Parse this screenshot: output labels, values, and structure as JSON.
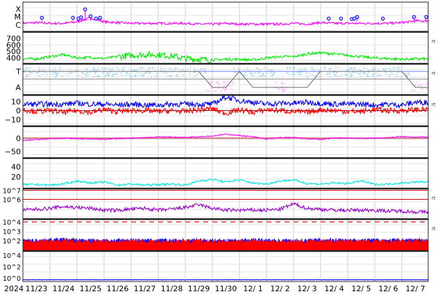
{
  "chart_data": {
    "type": "line",
    "title": "Space weather summary",
    "x_axis": {
      "year_label": "2024",
      "tick_labels": [
        "11/23",
        "11/24",
        "11/25",
        "11/26",
        "11/27",
        "11/28",
        "11/29",
        "11/30",
        "12/ 1",
        "12/ 2",
        "12/ 3",
        "12/ 4",
        "12/ 5",
        "12/ 6",
        "12/ 7"
      ],
      "points_per_day": 2
    },
    "panels": [
      {
        "name": "xray",
        "ytick_labels": [
          "X",
          "M",
          "C"
        ],
        "ylim_log": [
          -6.6,
          -3.8
        ],
        "ytick_values": [
          -4,
          -5,
          -6
        ],
        "rt": "",
        "series": [
          {
            "name": "xray-flux",
            "color": "#ff00ff",
            "values": [
              -5.8,
              -5.7,
              -5.8,
              -5.8,
              -5.6,
              -5.1,
              -5.6,
              -5.7,
              -5.8,
              -5.8,
              -5.8,
              -5.8,
              -5.8,
              -5.9,
              -5.9,
              -5.8,
              -5.9,
              -5.9,
              -5.9,
              -5.9,
              -5.8,
              -5.9,
              -5.7,
              -5.8,
              -5.8,
              -5.8,
              -5.8,
              -5.8,
              -5.7,
              -5.5
            ]
          }
        ],
        "flares_day": [
          0.7,
          1.85,
          2.05,
          2.15,
          2.3,
          2.5,
          2.7,
          2.85,
          11.3,
          11.75,
          12.15,
          12.25,
          12.35,
          13.3,
          14.45,
          14.9
        ],
        "flares_level": [
          -5.1,
          -5.1,
          -5.2,
          -5.05,
          -4.05,
          -4.9,
          -5.2,
          -5.1,
          -5.2,
          -5.2,
          -5.25,
          -5.2,
          -5.0,
          -5.2,
          -5.0,
          -5.0
        ]
      },
      {
        "name": "solar-wind-speed",
        "ytick_labels": [
          "700",
          "600",
          "500",
          "400"
        ],
        "ytick_values": [
          700,
          600,
          500,
          400
        ],
        "ylim": [
          310,
          800
        ],
        "rt": "rt",
        "series": [
          {
            "name": "speed",
            "color": "#00ee00",
            "values": [
              390,
              385,
              420,
              450,
              400,
              410,
              390,
              420,
              440,
              450,
              450,
              430,
              390,
              380,
              370,
              380,
              380,
              370,
              400,
              420,
              420,
              460,
              480,
              460,
              440,
              420,
              400,
              390,
              380,
              385
            ]
          }
        ]
      },
      {
        "name": "solar-wind-ta",
        "ytick_labels": [
          "T",
          "A"
        ],
        "rt": "rt",
        "series": [
          {
            "name": "temperature",
            "color": "#aaddff",
            "values": [
              1,
              1,
              1,
              1,
              1,
              1,
              1,
              1,
              1,
              1,
              1,
              1,
              1,
              1,
              0.3,
              0.2,
              1,
              1,
              1,
              0.3,
              1,
              1,
              1,
              1,
              1,
              1,
              1,
              1,
              1,
              0.3
            ]
          },
          {
            "name": "mode",
            "color": "#666666",
            "values": [
              1,
              1,
              1,
              1,
              1,
              1,
              1,
              1,
              1,
              1,
              1,
              1,
              1,
              1,
              0,
              0,
              1,
              0,
              0,
              0,
              0,
              0,
              1,
              1,
              1,
              1,
              1,
              1,
              1,
              0
            ]
          }
        ]
      },
      {
        "name": "imf",
        "ytick_labels": [
          "10",
          "0",
          "−10"
        ],
        "ytick_values": [
          10,
          0,
          -10
        ],
        "ylim": [
          -17,
          17
        ],
        "rt": "rt",
        "series": [
          {
            "name": "Bt",
            "color": "#0000ff",
            "values": [
              7,
              7,
              7,
              7,
              8,
              7,
              7,
              6,
              7,
              6,
              6,
              7,
              7,
              7,
              7,
              15,
              11,
              9,
              7,
              8,
              8,
              9,
              8,
              7,
              7,
              7,
              6,
              7,
              6,
              9
            ]
          },
          {
            "name": "Bz",
            "color": "#ff0000",
            "values": [
              1,
              -1,
              0,
              -2,
              0,
              -2,
              1,
              -1,
              0,
              0,
              -1,
              0,
              -1,
              1,
              2,
              -3,
              1,
              -2,
              1,
              0,
              -1,
              -2,
              1,
              0,
              -1,
              -1,
              1,
              0,
              0,
              1
            ]
          }
        ]
      },
      {
        "name": "dst",
        "ytick_labels": [
          "0",
          "−50"
        ],
        "ytick_values": [
          0,
          -50
        ],
        "ylim": [
          -75,
          45
        ],
        "rt": "",
        "series": [
          {
            "name": "dst",
            "color": "#ff00ff",
            "values": [
              -10,
              -5,
              -2,
              0,
              -2,
              -3,
              -5,
              -2,
              0,
              2,
              5,
              4,
              3,
              6,
              8,
              15,
              10,
              5,
              -3,
              2,
              3,
              -2,
              -5,
              0,
              1,
              -1,
              0,
              2,
              6,
              4
            ]
          }
        ]
      },
      {
        "name": "kp-index",
        "ytick_labels": [
          "40",
          "20"
        ],
        "ytick_values": [
          40,
          20
        ],
        "ylim": [
          -3,
          57
        ],
        "rt": "",
        "series": [
          {
            "name": "index",
            "color": "#00e5e5",
            "values": [
              5,
              5,
              4,
              6,
              12,
              8,
              10,
              4,
              6,
              4,
              5,
              6,
              4,
              12,
              15,
              10,
              14,
              8,
              6,
              12,
              14,
              7,
              6,
              8,
              7,
              12,
              5,
              6,
              8,
              10
            ]
          }
        ]
      },
      {
        "name": "electron-flux",
        "ytick_labels": [
          "10^7",
          "10^6"
        ],
        "ytick_values": [
          7,
          6
        ],
        "ylim_log": [
          3.8,
          7.2
        ],
        "threshold_lines": [
          7,
          6
        ],
        "rt": "rt",
        "series": [
          {
            "name": "electrons",
            "color": "#9900cc",
            "values": [
              4.8,
              4.9,
              5,
              5.2,
              5.1,
              5,
              4.8,
              4.8,
              4.9,
              5,
              4.8,
              4.9,
              5.1,
              5.4,
              5.0,
              4.8,
              4.8,
              4.8,
              4.8,
              4.9,
              5.5,
              5.0,
              4.9,
              4.8,
              4.8,
              4.8,
              4.8,
              4.7,
              4.7,
              4.6
            ]
          }
        ]
      },
      {
        "name": "proton-flux",
        "ytick_labels": [
          "10^4",
          "10^3",
          "10^2"
        ],
        "ytick_values": [
          4,
          3,
          2
        ],
        "ylim_log": [
          0.9,
          4.3
        ],
        "threshold_dashed": 4,
        "rt": "rt",
        "series": [
          {
            "name": "protons-high",
            "color": "#0000ff",
            "values": [
              2,
              2,
              2.05,
              2.1,
              2.05,
              2,
              2,
              2,
              2.05,
              2,
              2,
              2,
              2,
              2.05,
              2,
              2,
              2,
              2.05,
              2,
              2,
              2,
              2,
              2.05,
              2.1,
              2.05,
              2,
              2.05,
              2,
              2.05,
              2.05
            ]
          },
          {
            "name": "protons-low",
            "color": "#ff0000",
            "values": [
              1.9,
              1.9,
              1.95,
              2,
              1.95,
              1.9,
              1.9,
              1.9,
              1.95,
              1.9,
              1.9,
              1.9,
              1.9,
              1.95,
              1.9,
              1.9,
              1.9,
              1.95,
              1.9,
              1.9,
              1.9,
              1.9,
              1.95,
              1.95,
              1.95,
              1.9,
              1.95,
              1.9,
              1.95,
              1.95
            ]
          }
        ]
      },
      {
        "name": "high-energy-flux",
        "ytick_labels": [
          "10^4",
          "10^2",
          "10^0"
        ],
        "ytick_values": [
          4,
          2,
          0
        ],
        "ylim_log": [
          -0.6,
          4.7
        ],
        "rt": "",
        "series": [
          {
            "name": "flux",
            "color": "#0000ff",
            "values": [
              -0.3,
              -0.3,
              -0.3,
              -0.3,
              -0.3,
              -0.3,
              -0.3,
              -0.3,
              -0.3,
              -0.3,
              -0.3,
              -0.3,
              -0.3,
              -0.3,
              -0.3,
              -0.3,
              -0.3,
              -0.3,
              -0.3,
              -0.3,
              -0.3,
              -0.3,
              -0.3,
              -0.3,
              -0.3,
              -0.3,
              -0.3,
              -0.3,
              -0.3,
              -0.3
            ]
          }
        ]
      }
    ]
  }
}
